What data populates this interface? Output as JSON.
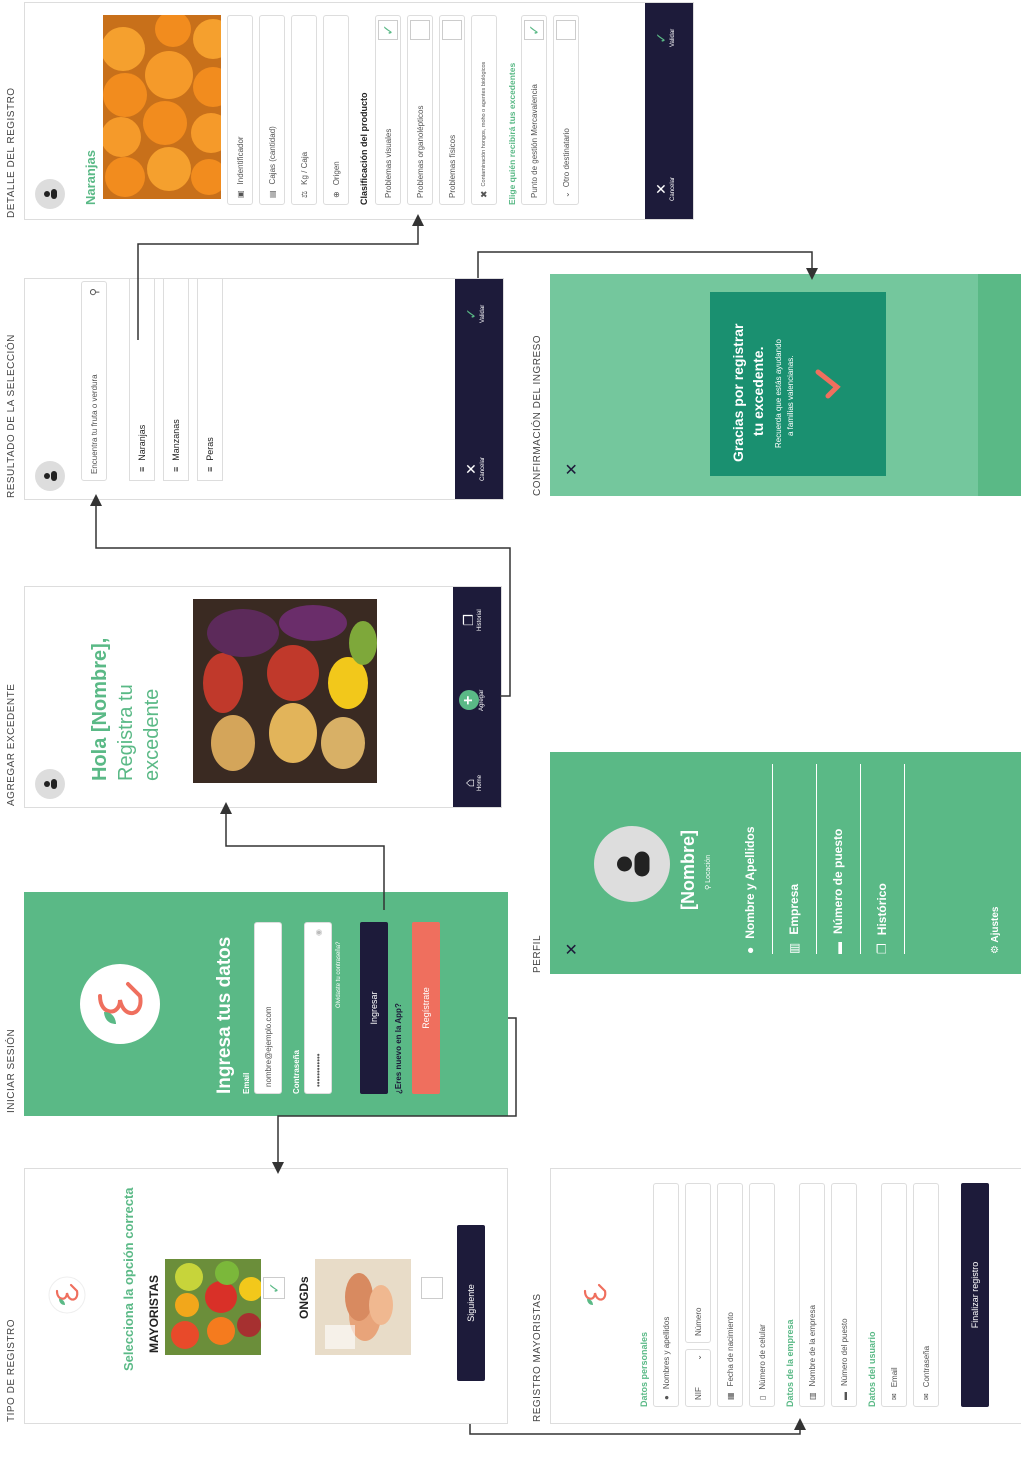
{
  "captions": {
    "tipo": "TIPO DE REGISTRO",
    "login": "INICIAR SESIÓN",
    "agregar": "AGREGAR EXCEDENTE",
    "resultado": "RESULTADO DE LA SELECCIÓN",
    "detalle": "DETALLE DEL REGISTRO",
    "mayoristas": "REGISTRO MAYORISTAS",
    "perfil": "PERFIL",
    "confirmacion": "CONFIRMACIÓN DEL INGRESO"
  },
  "tipo": {
    "title": "Selecciona la opción correcta",
    "option1": "MAYORISTAS",
    "option2": "ONGDs",
    "option1_checked": true,
    "option2_checked": false,
    "next": "Siguiente"
  },
  "login": {
    "title": "Ingresa tus datos",
    "email_label": "Email",
    "email_value": "nombre@ejemplo.com",
    "password_label": "Contraseña",
    "password_value": "••••••••••••",
    "forgot": "Olvidaste tu contraseña?",
    "login_btn": "Ingresar",
    "new_question": "¿Eres nuevo en la App?",
    "register_btn": "Regístrate"
  },
  "agregar": {
    "greeting": "Hola [Nombre],",
    "line2": "Registra tu",
    "line3": "excedente",
    "nav_home": "Home",
    "nav_add": "Agregar",
    "nav_history": "Historial"
  },
  "resultado": {
    "search_placeholder": "Encuentra tu fruta o verdura",
    "items": [
      "Naranjas",
      "Manzanas",
      "Peras"
    ],
    "cancel": "Cancelar",
    "validate": "Validar"
  },
  "detalle": {
    "title": "Naranjas",
    "fields": [
      "Indentificador",
      "Cajas (cantidad)",
      "Kg / Caja",
      "Origen"
    ],
    "class_title": "Clasificación del producto",
    "class_items": [
      "Problemas visuales",
      "Problemas organolépticos",
      "Problemas físicos",
      "Contaminación hongos, moho o agentes biológicos"
    ],
    "class_checked": [
      true,
      false,
      false,
      false
    ],
    "dest_title": "Elige quién recibirá tus excedentes",
    "dest_items": [
      "Punto de gestión Mercavalencia",
      "Otro destinatario"
    ],
    "dest_checked": [
      true,
      false
    ],
    "cancel": "Cancelar",
    "validate": "Validar"
  },
  "mayoristas": {
    "personal_title": "Datos personales",
    "name_field": "Nombres y apellidos",
    "doc_type": "NIF",
    "doc_number": "Número",
    "birth": "Fecha de nacimiento",
    "phone": "Número de celular",
    "company_title": "Datos de la empresa",
    "company_name": "Nombre de la empresa",
    "post_number": "Número del puesto",
    "user_title": "Datos del usuario",
    "email": "Email",
    "password": "Contraseña",
    "finish": "Finalizar registro"
  },
  "perfil": {
    "name": "[Nombre]",
    "location": "Locación",
    "menu": [
      "Nombre y Apellidos",
      "Empresa",
      "Número de puesto",
      "Histórico"
    ],
    "settings": "Ajustes"
  },
  "confirmacion": {
    "line1": "Gracias por registrar",
    "line2": "tu excedente.",
    "line3": "Recuerda que estás ayudando",
    "line4": "a familias valencianas."
  },
  "colors": {
    "green": "#5ab986",
    "dark": "#1d1b3a",
    "coral": "#ef6f5e",
    "teal": "#1a9070"
  }
}
